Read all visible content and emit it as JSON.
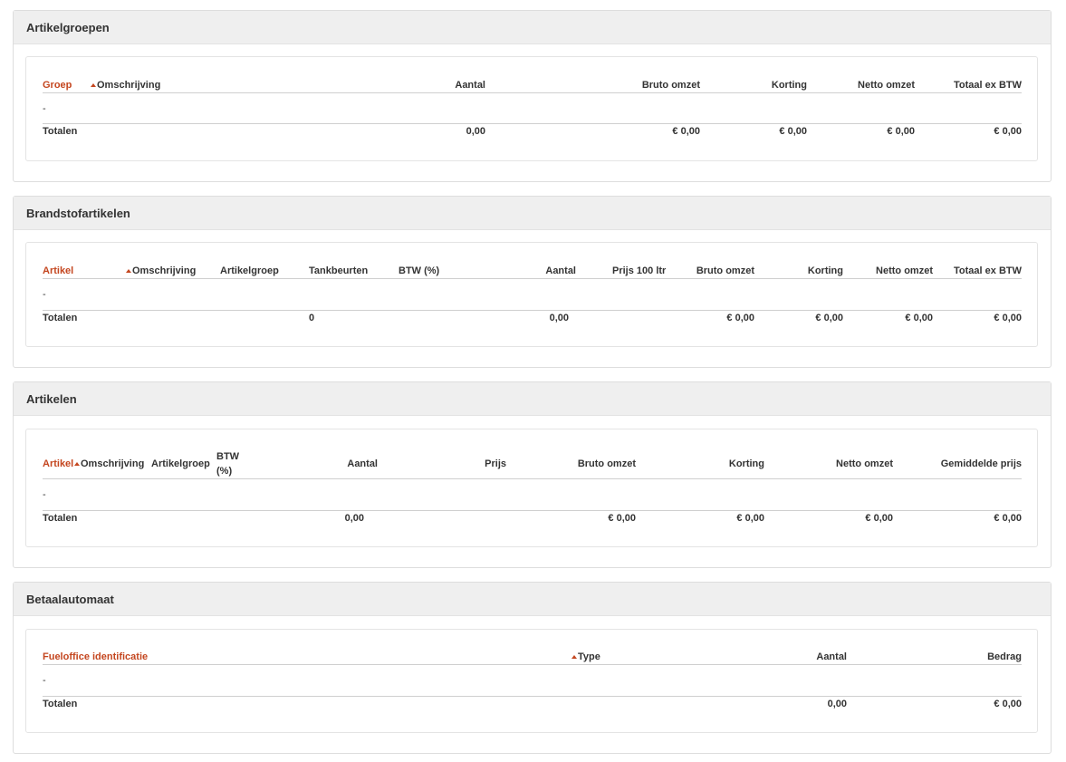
{
  "artikelgroepen": {
    "title": "Artikelgroepen",
    "headers": {
      "groep": "Groep",
      "omschrijving": "Omschrijving",
      "aantal": "Aantal",
      "bruto": "Bruto omzet",
      "korting": "Korting",
      "netto": "Netto omzet",
      "totaal": "Totaal ex BTW"
    },
    "empty_row": "-",
    "totals": {
      "label": "Totalen",
      "aantal": "0,00",
      "bruto": "€ 0,00",
      "korting": "€ 0,00",
      "netto": "€ 0,00",
      "totaal": "€ 0,00"
    }
  },
  "brandstofartikelen": {
    "title": "Brandstofartikelen",
    "headers": {
      "artikel": "Artikel",
      "omschrijving": "Omschrijving",
      "artikelgroep": "Artikelgroep",
      "tankbeurten": "Tankbeurten",
      "btw": "BTW (%)",
      "aantal": "Aantal",
      "prijs100": "Prijs 100 ltr",
      "bruto": "Bruto omzet",
      "korting": "Korting",
      "netto": "Netto omzet",
      "totaal": "Totaal ex BTW"
    },
    "empty_row": "-",
    "totals": {
      "label": "Totalen",
      "tankbeurten": "0",
      "aantal": "0,00",
      "bruto": "€ 0,00",
      "korting": "€ 0,00",
      "netto": "€ 0,00",
      "totaal": "€ 0,00"
    }
  },
  "artikelen": {
    "title": "Artikelen",
    "headers": {
      "artikel": "Artikel",
      "omschrijving": "Omschrijving",
      "artikelgroep": "Artikelgroep",
      "btw_line1": "BTW",
      "btw_line2": "(%)",
      "aantal": "Aantal",
      "prijs": "Prijs",
      "bruto": "Bruto omzet",
      "korting": "Korting",
      "netto": "Netto omzet",
      "gemiddelde": "Gemiddelde prijs"
    },
    "empty_row": "-",
    "totals": {
      "label": "Totalen",
      "aantal": "0,00",
      "bruto": "€ 0,00",
      "korting": "€ 0,00",
      "netto": "€ 0,00",
      "gemiddelde": "€ 0,00"
    }
  },
  "betaalautomaat": {
    "title": "Betaalautomaat",
    "headers": {
      "identificatie": "Fueloffice identificatie",
      "type": "Type",
      "aantal": "Aantal",
      "bedrag": "Bedrag"
    },
    "empty_row": "-",
    "totals": {
      "label": "Totalen",
      "aantal": "0,00",
      "bedrag": "€ 0,00"
    }
  },
  "colors": {
    "sort_accent": "#c4461f",
    "panel_header_bg": "#efefef"
  }
}
